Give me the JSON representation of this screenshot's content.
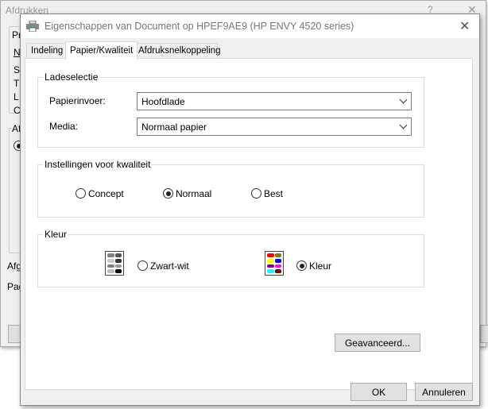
{
  "background_window": {
    "title": "Afdrukken",
    "help": "?",
    "close": "✕",
    "partial_labels": [
      "Pr",
      "N",
      "S",
      "T",
      "L",
      "C",
      "Af",
      "Afg",
      "Pag"
    ]
  },
  "dialog": {
    "title": "Eigenschappen van Document op HPEF9AE9 (HP ENVY 4520 series)",
    "close": "✕",
    "tabs": [
      {
        "label": "Indeling",
        "active": false
      },
      {
        "label": "Papier/Kwaliteit",
        "active": true
      },
      {
        "label": "Afdruksnelkoppeling",
        "active": false
      }
    ],
    "tray": {
      "title": "Ladeselectie",
      "source_label": "Papierinvoer:",
      "source_value": "Hoofdlade",
      "media_label": "Media:",
      "media_value": "Normaal papier"
    },
    "quality": {
      "title": "Instellingen voor kwaliteit",
      "options": [
        {
          "label": "Concept",
          "selected": false
        },
        {
          "label": "Normaal",
          "selected": true
        },
        {
          "label": "Best",
          "selected": false
        }
      ]
    },
    "color": {
      "title": "Kleur",
      "options": [
        {
          "label": "Zwart-wit",
          "selected": false,
          "icon": "grayscale-doc-icon"
        },
        {
          "label": "Kleur",
          "selected": true,
          "icon": "color-doc-icon"
        }
      ]
    },
    "advanced_label": "Geavanceerd...",
    "ok_label": "OK",
    "cancel_label": "Annuleren"
  }
}
